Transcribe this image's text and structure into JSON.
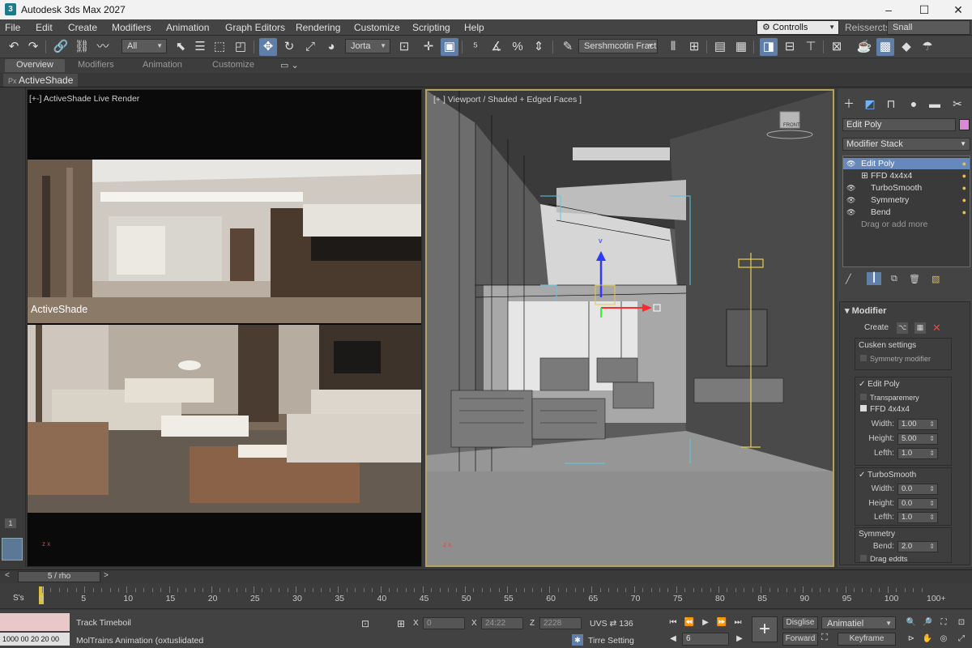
{
  "titlebar": {
    "title": "Autodesk 3ds Max 2027",
    "logo": "3",
    "minimize": "–",
    "maximize": "☐",
    "close": "✕"
  },
  "menu": [
    "File",
    "Edit",
    "Create",
    "Modifiers",
    "Animation",
    "Graph Editors",
    "Rendering",
    "Customize",
    "Scripting",
    "Help"
  ],
  "workspace": {
    "combo": "Controlls",
    "label": "Reissercts",
    "value": "Snall"
  },
  "toolbar": {
    "filter": "All",
    "coord_combo": "Jorta",
    "named_sel": "Sershmcotin Fract"
  },
  "ribbon": {
    "tabs": [
      "Overview",
      "Modifiers",
      "Animation",
      "Customize"
    ],
    "active_label": "ActiveShade"
  },
  "viewport_left": {
    "label": "[+-] ActiveShade Live Render",
    "render_label": "ActiveShade",
    "axis": "z x"
  },
  "viewport_right": {
    "label": "[+ ] Viewport / Shaded + Edged Faces ]",
    "viewcube": "FRONT",
    "gizmo_y": "v"
  },
  "leftstrip": {
    "badge": "1"
  },
  "cmdpanel": {
    "object_name": "Edit Poly",
    "object_color": "#d88ad6",
    "modifier_list": "Modifier Stack",
    "stack": [
      {
        "label": "Edit Poly",
        "selected": true
      },
      {
        "label": "FFD 4x4x4"
      },
      {
        "label": "TurboSmooth"
      },
      {
        "label": "Symmetry"
      },
      {
        "label": "Bend"
      },
      {
        "label": "Drag or add more"
      }
    ],
    "rollout_title": "Modifier",
    "create_label": "Create",
    "cusken": {
      "title": "Cusken settings",
      "item": "Symmetry modifier"
    },
    "editpoly": {
      "title": "Edit Poly",
      "transp": "Transparemery",
      "ffd": "FFD 4x4x4",
      "params": [
        {
          "label": "Width:",
          "value": "1.00"
        },
        {
          "label": "Height:",
          "value": "5.00"
        },
        {
          "label": "Lefth:",
          "value": "1.0"
        }
      ]
    },
    "turbosmooth": {
      "title": "TurboSmooth",
      "params": [
        {
          "label": "Width:",
          "value": "0.0"
        },
        {
          "label": "Height:",
          "value": "0.0"
        },
        {
          "label": "Lefth:",
          "value": "1.0"
        }
      ]
    },
    "symmetry": {
      "title": "Symmetry",
      "bend_label": "Bend:",
      "bend_value": "2.0",
      "drag": "Drag eddts"
    }
  },
  "timeline": {
    "frame": "5 / rho",
    "ruler_label": "S's",
    "ticks": [
      "0",
      "5",
      "10",
      "15",
      "20",
      "25",
      "30",
      "35",
      "40",
      "45",
      "50",
      "55",
      "60",
      "65",
      "70",
      "75",
      "80",
      "85",
      "90",
      "95",
      "100",
      "100+"
    ]
  },
  "status": {
    "mini_field": "1000  00 20 20  00",
    "track": "Track Timeboil",
    "prompt": "MolTrains Animation (oxtuslidated",
    "x_label": "X",
    "x_value": "0",
    "y_label": "X",
    "y_value": "24:22",
    "z_label": "Z",
    "z_value": "2228",
    "uvs": "UVS ⇄ 136",
    "time_setting": "Tirre Setting",
    "frame_field": "6",
    "disglise": "Disglise",
    "forward": "Forward",
    "anim_combo": "Animatiel",
    "keyframe": "Keyframe"
  }
}
